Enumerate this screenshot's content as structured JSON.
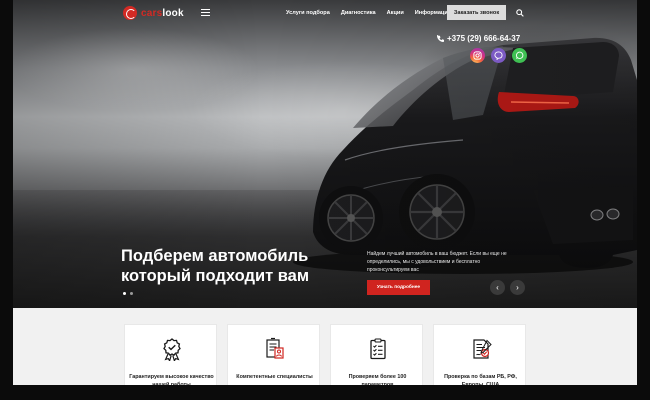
{
  "header": {
    "logo": {
      "part1": "cars",
      "part2": "look"
    },
    "nav": [
      {
        "label": "Услуги подбора"
      },
      {
        "label": "Диагностика"
      },
      {
        "label": "Акции"
      },
      {
        "label": "Информация"
      }
    ],
    "call_button": "Заказать звонок"
  },
  "contacts": {
    "phone": "+375 (29) 666-64-37",
    "socials": [
      "instagram-icon",
      "viber-icon",
      "whatsapp-icon"
    ]
  },
  "hero": {
    "headline_line1": "Подберем автомобиль",
    "headline_line2": "который подходит вам",
    "description": "Найдем лучший автомобиль в ваш бюджет. Если вы еще не определились, мы с удовольствием и бесплатно проконсультируем вас",
    "more_button": "Узнать подробнее",
    "slides_total": 2,
    "slide_active": 1
  },
  "features": [
    {
      "icon": "award-badge-icon",
      "text": "Гарантируем высокое качество нашей работы"
    },
    {
      "icon": "specialist-document-icon",
      "text": "Компетентные специалисты"
    },
    {
      "icon": "checklist-icon",
      "text": "Проверяем более 100 параметров"
    },
    {
      "icon": "contract-check-icon",
      "text": "Проверка по базам РБ, РФ, Европы, США"
    }
  ],
  "colors": {
    "accent": "#d0241f",
    "brand_red": "#d32a24",
    "instagram": "#d7317f",
    "viber": "#7c5ac4",
    "whatsapp": "#3fbf53"
  }
}
